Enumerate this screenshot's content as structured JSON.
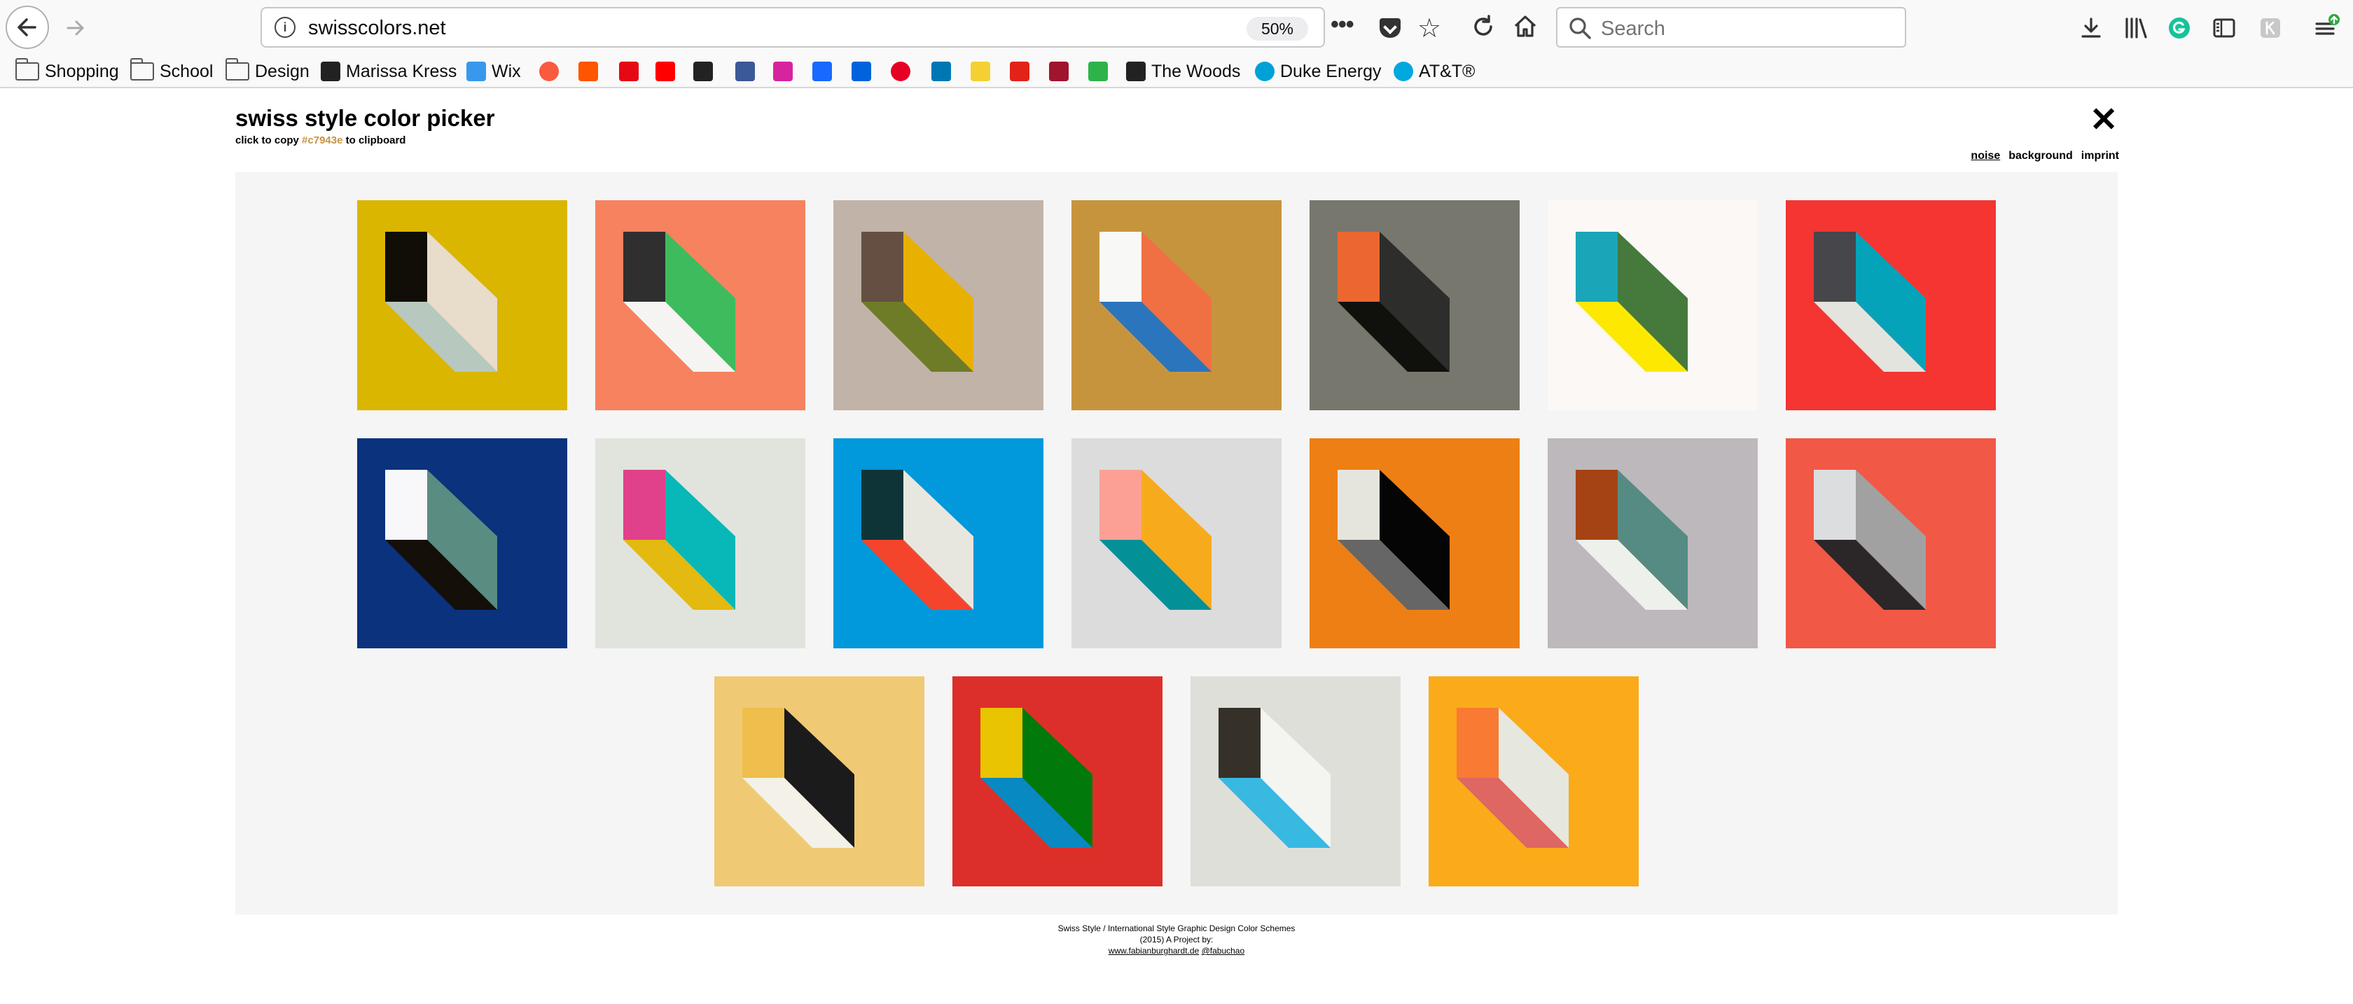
{
  "browser": {
    "url": "swisscolors.net",
    "zoom": "50%",
    "search_placeholder": "Search",
    "bookmarks": [
      {
        "label": "Shopping",
        "icon": "folder-icon"
      },
      {
        "label": "School",
        "icon": "folder-icon"
      },
      {
        "label": "Design",
        "icon": "folder-icon"
      },
      {
        "label": "Marissa Kress",
        "icon": "mk-logo-icon"
      },
      {
        "label": "Wix",
        "icon": "wix-icon"
      },
      {
        "label": "",
        "icon": "apple-music-icon",
        "color": "#fa5a3d"
      },
      {
        "label": "",
        "icon": "soundcloud-icon",
        "color": "#ff5500"
      },
      {
        "label": "",
        "icon": "netflix-icon",
        "color": "#e50914"
      },
      {
        "label": "",
        "icon": "youtube-icon",
        "color": "#ff0000"
      },
      {
        "label": "",
        "icon": "buffer-icon",
        "color": "#222222"
      },
      {
        "label": "",
        "icon": "facebook-icon",
        "color": "#3b5998"
      },
      {
        "label": "",
        "icon": "instagram-icon",
        "color": "#d6249f"
      },
      {
        "label": "",
        "icon": "behance-icon",
        "color": "#1769ff"
      },
      {
        "label": "",
        "icon": "flickr-icon",
        "color": "#0063dc"
      },
      {
        "label": "",
        "icon": "pinterest-icon",
        "color": "#e60023"
      },
      {
        "label": "",
        "icon": "linkedin-icon",
        "color": "#0077b5"
      },
      {
        "label": "",
        "icon": "fontshop-icon",
        "color": "#f5d033"
      },
      {
        "label": "",
        "icon": "red-swoosh-icon",
        "color": "#e2231a"
      },
      {
        "label": "",
        "icon": "red-shield-icon",
        "color": "#a0142e"
      },
      {
        "label": "",
        "icon": "green-arrow-icon",
        "color": "#2db34a"
      },
      {
        "label": "The Woods",
        "icon": "woods-icon"
      },
      {
        "label": "Duke Energy",
        "icon": "duke-energy-icon"
      },
      {
        "label": "AT&T®",
        "icon": "att-icon"
      }
    ]
  },
  "page": {
    "title": "swiss style color picker",
    "copy_prefix": "click to copy",
    "copy_hex": "#c7943e",
    "copy_suffix": "to clipboard",
    "close_symbol": "✕",
    "menu": {
      "noise": "noise",
      "background": "background",
      "imprint": "imprint"
    },
    "footer": {
      "line1": "Swiss Style / International Style Graphic Design Color Schemes",
      "line2": "(2015) A Project by:",
      "link1": "www.fabianburghardt.de",
      "link2": "@fabuchao"
    }
  },
  "swatches": [
    {
      "bg": "#dab600",
      "front": "#110d07",
      "top": "#e8dccb",
      "side": "#b7c9be"
    },
    {
      "bg": "#f6825f",
      "front": "#2f2f2f",
      "top": "#3dbb5d",
      "side": "#f5f4f2"
    },
    {
      "bg": "#c1b3a7",
      "front": "#654f43",
      "top": "#e8b000",
      "side": "#6e7c27"
    },
    {
      "bg": "#c7943e",
      "front": "#f8f8f6",
      "top": "#f07043",
      "side": "#2b75bc"
    },
    {
      "bg": "#77776d",
      "front": "#ec672f",
      "top": "#2d2d2b",
      "side": "#10110d"
    },
    {
      "bg": "#fcf8f6",
      "front": "#1aa6b8",
      "top": "#457a3c",
      "side": "#fde801"
    },
    {
      "bg": "#f43532",
      "front": "#46464b",
      "top": "#04a3b9",
      "side": "#e2e4dd"
    },
    {
      "bg": "#0a327d",
      "front": "#f8f8fa",
      "top": "#5a8c82",
      "side": "#140f09"
    },
    {
      "bg": "#e0e4dc",
      "front": "#e0418a",
      "top": "#08b7b8",
      "side": "#e4b910"
    },
    {
      "bg": "#0198dc",
      "front": "#0f3437",
      "top": "#e7e7df",
      "side": "#f4452c"
    },
    {
      "bg": "#dcdcdc",
      "front": "#fca095",
      "top": "#f8aa1d",
      "side": "#039097"
    },
    {
      "bg": "#ee7f14",
      "front": "#e6e5dd",
      "top": "#050505",
      "side": "#666666"
    },
    {
      "bg": "#bdb8bb",
      "front": "#a64315",
      "top": "#568b84",
      "side": "#eef0ec"
    },
    {
      "bg": "#f15846",
      "front": "#dcdddf",
      "top": "#a1a1a1",
      "side": "#2b2728"
    },
    {
      "bg": "#f0c975",
      "front": "#efbe4c",
      "top": "#1b1b1b",
      "side": "#f3f1e8"
    },
    {
      "bg": "#dd2f2a",
      "front": "#e9c400",
      "top": "#01790b",
      "side": "#0889c2"
    },
    {
      "bg": "#dfdfda",
      "front": "#353128",
      "top": "#f4f5f0",
      "side": "#38b9e2"
    },
    {
      "bg": "#fbaa1a",
      "front": "#f97a32",
      "top": "#e6e7df",
      "side": "#de6663"
    }
  ]
}
